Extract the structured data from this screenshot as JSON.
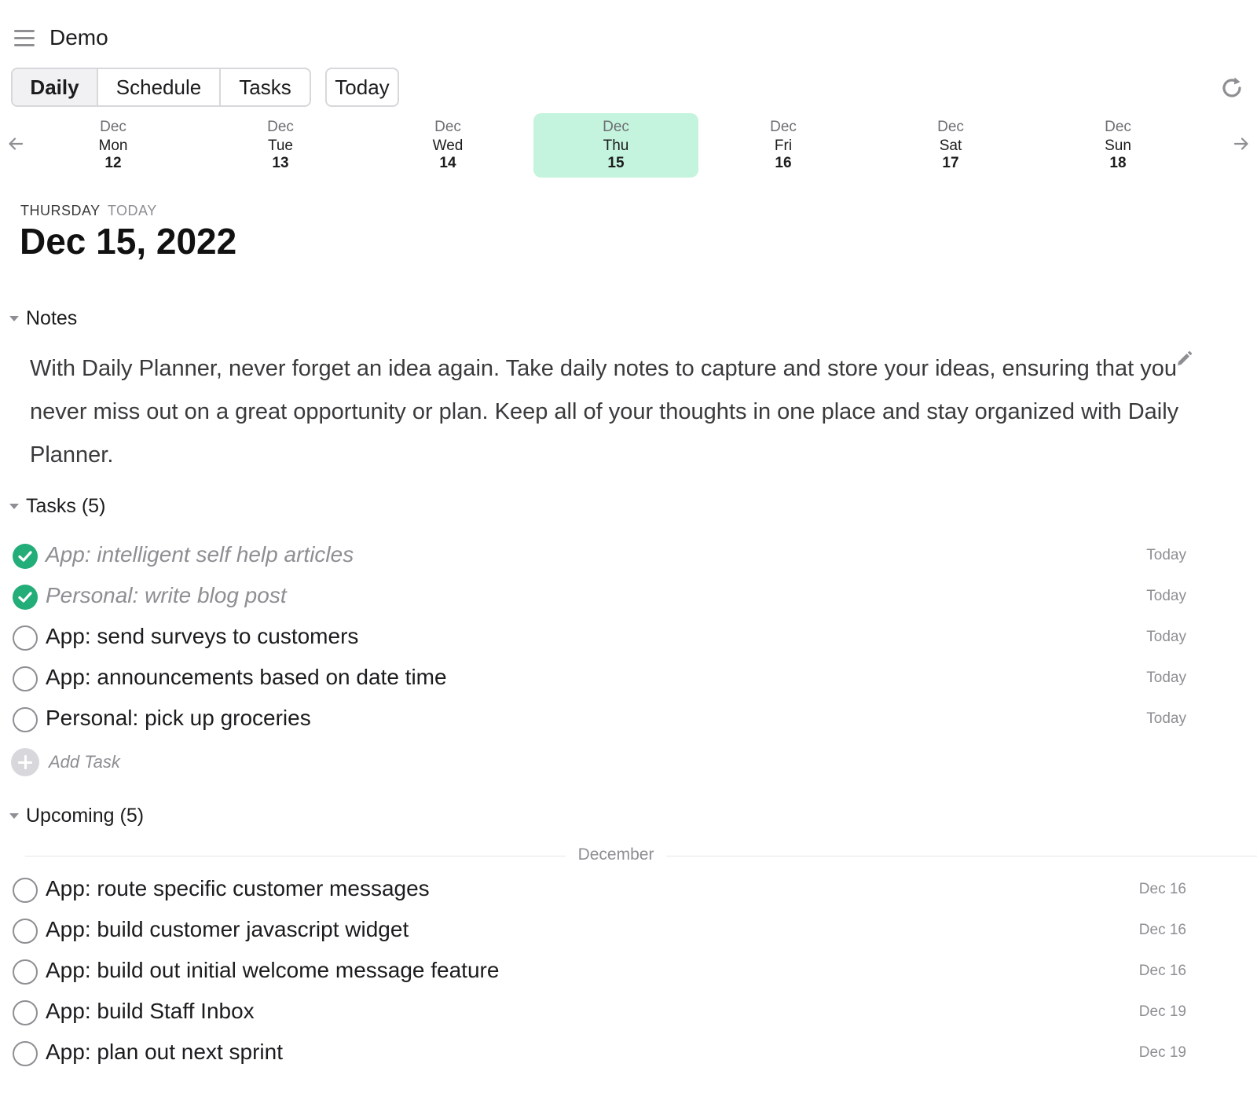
{
  "header": {
    "title": "Demo"
  },
  "toolbar": {
    "tabs": [
      {
        "label": "Daily",
        "active": true
      },
      {
        "label": "Schedule",
        "active": false
      },
      {
        "label": "Tasks",
        "active": false
      }
    ],
    "today_label": "Today"
  },
  "week": {
    "days": [
      {
        "month": "Dec",
        "name": "Mon",
        "num": "12",
        "selected": false
      },
      {
        "month": "Dec",
        "name": "Tue",
        "num": "13",
        "selected": false
      },
      {
        "month": "Dec",
        "name": "Wed",
        "num": "14",
        "selected": false
      },
      {
        "month": "Dec",
        "name": "Thu",
        "num": "15",
        "selected": true
      },
      {
        "month": "Dec",
        "name": "Fri",
        "num": "16",
        "selected": false
      },
      {
        "month": "Dec",
        "name": "Sat",
        "num": "17",
        "selected": false
      },
      {
        "month": "Dec",
        "name": "Sun",
        "num": "18",
        "selected": false
      }
    ],
    "selected_color": "#c5f4de"
  },
  "date_heading": {
    "weekday": "THURSDAY",
    "today_tag": "TODAY",
    "date": "Dec 15, 2022"
  },
  "notes": {
    "title": "Notes",
    "body": "With Daily Planner, never forget an idea again. Take daily notes to capture and store your ideas, ensuring that you never miss out on a great opportunity or plan. Keep all of your thoughts in one place and stay organized with Daily Planner."
  },
  "tasks": {
    "title": "Tasks (5)",
    "items": [
      {
        "title": "App: intelligent self help articles",
        "date": "Today",
        "done": true
      },
      {
        "title": "Personal: write blog post",
        "date": "Today",
        "done": true
      },
      {
        "title": "App: send surveys to customers",
        "date": "Today",
        "done": false
      },
      {
        "title": "App: announcements based on date time",
        "date": "Today",
        "done": false
      },
      {
        "title": "Personal: pick up groceries",
        "date": "Today",
        "done": false
      }
    ],
    "add_label": "Add Task"
  },
  "upcoming": {
    "title": "Upcoming (5)",
    "month": "December",
    "items": [
      {
        "title": "App: route specific customer messages",
        "date": "Dec 16",
        "done": false
      },
      {
        "title": "App: build customer javascript widget",
        "date": "Dec 16",
        "done": false
      },
      {
        "title": "App: build out initial welcome message feature",
        "date": "Dec 16",
        "done": false
      },
      {
        "title": "App: build Staff Inbox",
        "date": "Dec 19",
        "done": false
      },
      {
        "title": "App: plan out next sprint",
        "date": "Dec 19",
        "done": false
      }
    ]
  },
  "colors": {
    "accent_green": "#23ad78",
    "muted_text": "#8e8e93"
  }
}
